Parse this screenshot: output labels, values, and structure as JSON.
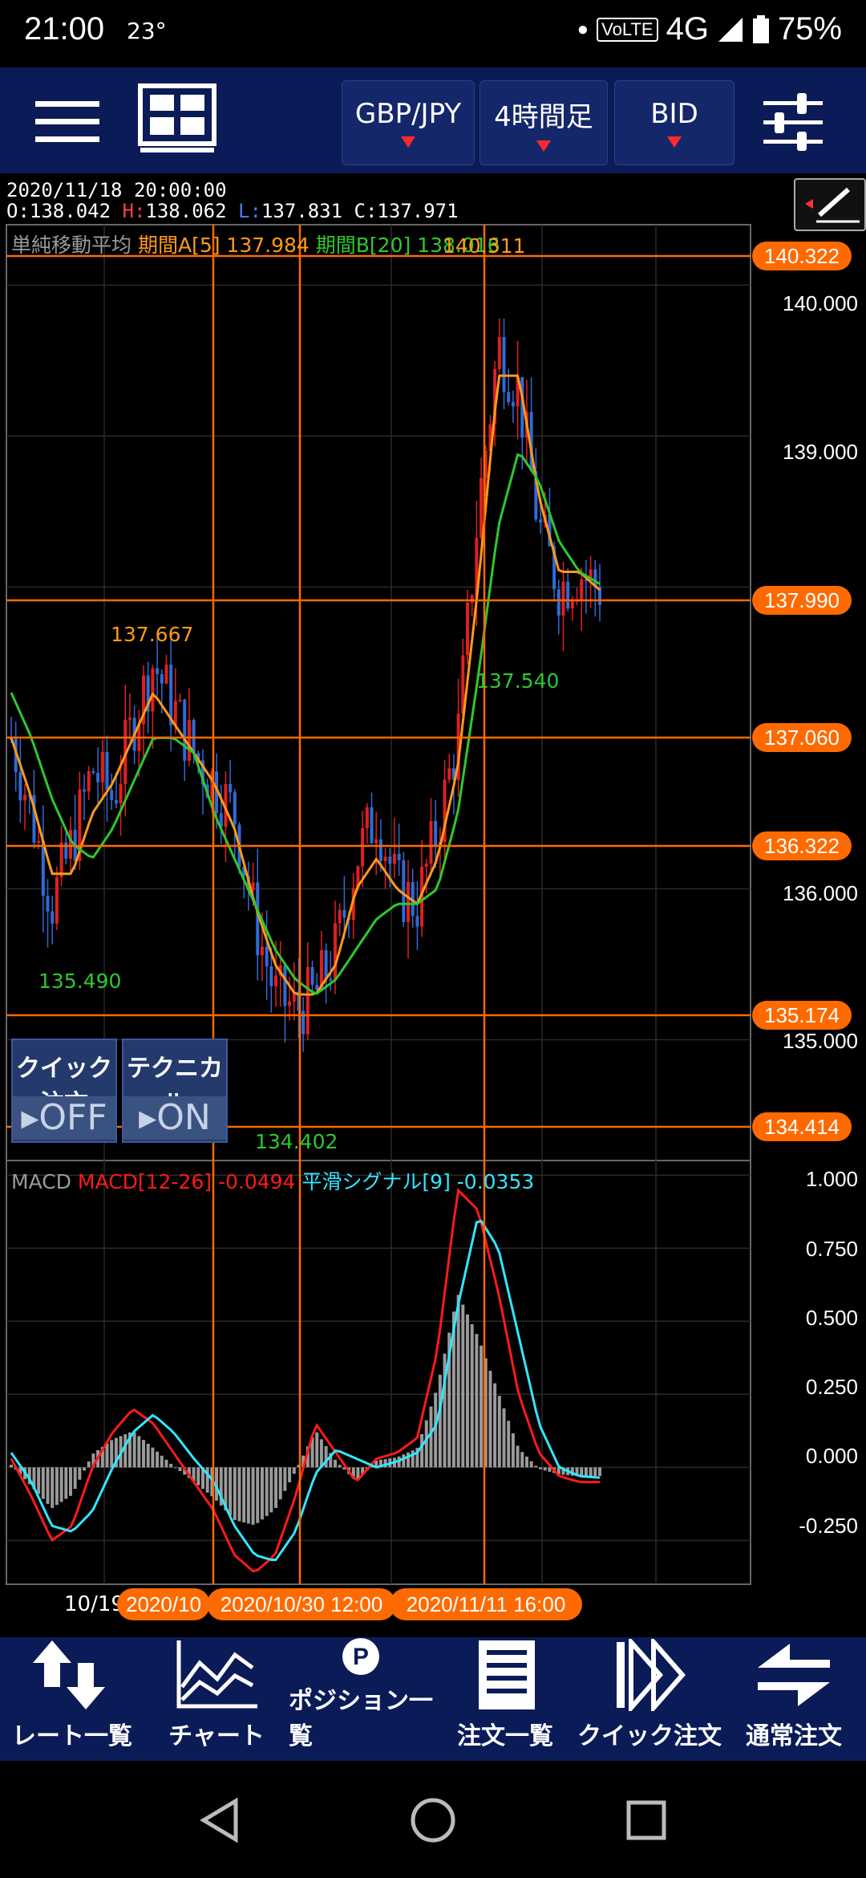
{
  "status": {
    "time": "21:00",
    "temperature": "23°",
    "network": "4G",
    "volte": "VoLTE",
    "battery": "75%"
  },
  "header": {
    "pair": "GBP/JPY",
    "timeframe": "4時間足",
    "price_type": "BID"
  },
  "ohlc": {
    "datetime": "2020/11/18 20:00:00",
    "open": "O:138.042",
    "high_prefix": "H:",
    "high": "138.062",
    "low_prefix": "L:",
    "low": "137.831",
    "close": "C:137.971"
  },
  "sma_label": {
    "name": "単純移動平均",
    "a": "期間A[5] 137.984",
    "b": "期間B[20] 138.016"
  },
  "macd_label": {
    "name": "MACD",
    "macd": "MACD[12-26] -0.0494",
    "signal": "平滑シグナル[9] -0.0353"
  },
  "price_tags": [
    "140.322",
    "137.990",
    "137.060",
    "136.322",
    "135.174",
    "134.414"
  ],
  "price_axis": [
    "140.000",
    "139.000",
    "136.000",
    "135.000"
  ],
  "macd_axis": [
    "1.000",
    "0.750",
    "0.500",
    "0.250",
    "0.000",
    "-0.250"
  ],
  "annotations": {
    "high": "140.311",
    "peak_left": "137.667",
    "min_left": "135.490",
    "min_mid": "134.402",
    "swing": "137.540"
  },
  "overlay": {
    "quick_order": "クイック注文",
    "quick_state": "OFF",
    "technical": "テクニカル",
    "technical_state": "ON"
  },
  "dates": {
    "first": "10/19",
    "tag1": "2020/10",
    "tag2": "2020/10/30 12:00",
    "tag3": "2020/11/11 16:00"
  },
  "nav": [
    "レート一覧",
    "チャート",
    "ポジション一覧",
    "注文一覧",
    "クイック注文",
    "通常注文"
  ],
  "colors": {
    "header_bg": "#0b1b57",
    "accent": "#ff6a00",
    "sma_a": "#ff9a1a",
    "sma_b": "#2ec82e",
    "macd": "#ff1a1a",
    "signal": "#33e6ff",
    "candle_up": "#e02020",
    "candle_down": "#2f6bd8"
  },
  "chart_data": {
    "type": "candlestick",
    "pair": "GBP/JPY",
    "ylim": [
      134.2,
      140.4
    ],
    "macd_ylim": [
      -0.4,
      1.05
    ],
    "close_approx": [
      137.0,
      136.5,
      135.9,
      136.3,
      136.8,
      136.6,
      137.1,
      137.5,
      137.2,
      136.9,
      136.7,
      136.5,
      135.8,
      135.3,
      135.2,
      135.3,
      135.6,
      136.2,
      136.5,
      136.0,
      135.9,
      136.4,
      137.0,
      138.5,
      139.6,
      139.3,
      138.4,
      138.0,
      138.1,
      137.99
    ],
    "sma_a_approx": [
      137.0,
      136.6,
      136.1,
      136.1,
      136.5,
      136.7,
      137.0,
      137.3,
      137.1,
      136.9,
      136.7,
      136.4,
      135.9,
      135.5,
      135.3,
      135.3,
      135.5,
      136.0,
      136.2,
      136.0,
      135.9,
      136.2,
      136.8,
      138.0,
      139.4,
      139.4,
      138.6,
      138.1,
      138.1,
      137.98
    ],
    "sma_b_approx": [
      137.3,
      137.0,
      136.6,
      136.3,
      136.2,
      136.4,
      136.7,
      137.0,
      137.0,
      136.9,
      136.5,
      136.2,
      135.9,
      135.6,
      135.4,
      135.3,
      135.4,
      135.6,
      135.8,
      135.9,
      135.9,
      136.0,
      136.5,
      137.4,
      138.4,
      138.9,
      138.7,
      138.3,
      138.1,
      138.02
    ],
    "macd_approx": [
      0.03,
      -0.1,
      -0.25,
      -0.2,
      0.0,
      0.12,
      0.2,
      0.15,
      0.05,
      -0.05,
      -0.15,
      -0.3,
      -0.36,
      -0.3,
      -0.1,
      0.15,
      0.05,
      -0.05,
      0.03,
      0.05,
      0.1,
      0.4,
      0.95,
      0.88,
      0.6,
      0.25,
      0.05,
      -0.03,
      -0.05,
      -0.05
    ],
    "signal_approx": [
      0.05,
      -0.05,
      -0.2,
      -0.22,
      -0.15,
      0.0,
      0.12,
      0.18,
      0.12,
      0.03,
      -0.05,
      -0.2,
      -0.3,
      -0.32,
      -0.22,
      -0.02,
      0.06,
      0.03,
      0.0,
      0.02,
      0.05,
      0.15,
      0.55,
      0.86,
      0.75,
      0.45,
      0.15,
      0.0,
      -0.03,
      -0.035
    ]
  }
}
